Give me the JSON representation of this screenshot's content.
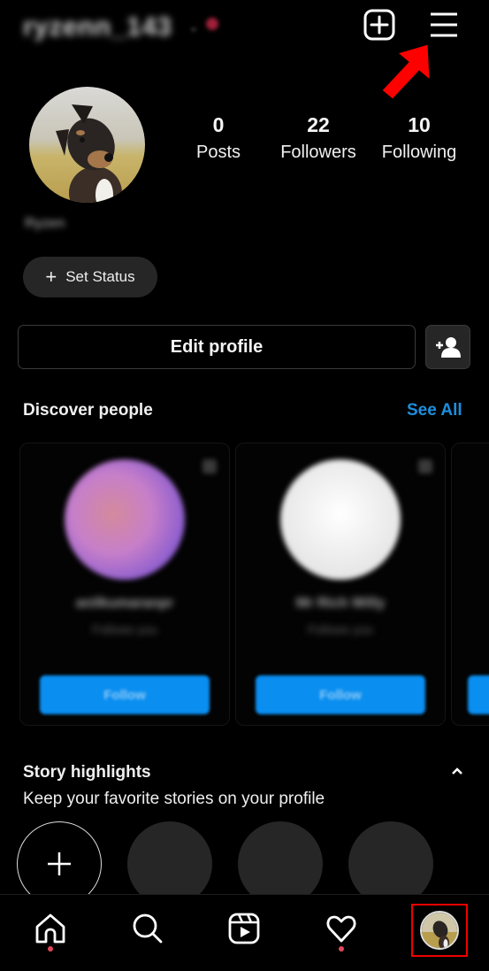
{
  "header": {
    "username": "ryzenn_143",
    "caret": "⌄",
    "icons": [
      "new-post-icon",
      "menu-icon"
    ]
  },
  "profile": {
    "stats": [
      {
        "value": "0",
        "label": "Posts"
      },
      {
        "value": "22",
        "label": "Followers"
      },
      {
        "value": "10",
        "label": "Following"
      }
    ],
    "full_name": "Ryzen",
    "set_status_icon": "+",
    "set_status_label": "Set Status",
    "edit_profile_label": "Edit profile"
  },
  "discover": {
    "title": "Discover people",
    "see_all": "See All",
    "cards": [
      {
        "name": "anilkumaranpr",
        "subtitle": "Follows you",
        "button": "Follow"
      },
      {
        "name": "Mr Rich Willy",
        "subtitle": "Follows you",
        "button": "Follow"
      }
    ]
  },
  "highlights": {
    "title": "Story highlights",
    "subtitle": "Keep your favorite stories on your profile"
  },
  "bottom_nav": {
    "items": [
      "home",
      "search",
      "reels",
      "activity",
      "profile"
    ],
    "highlighted_item": "profile"
  },
  "colors": {
    "accent": "#1b8fe0",
    "follow_button": "#0a8ef0",
    "annotation": "#ee0000",
    "notification_dot": "#e3485b"
  }
}
